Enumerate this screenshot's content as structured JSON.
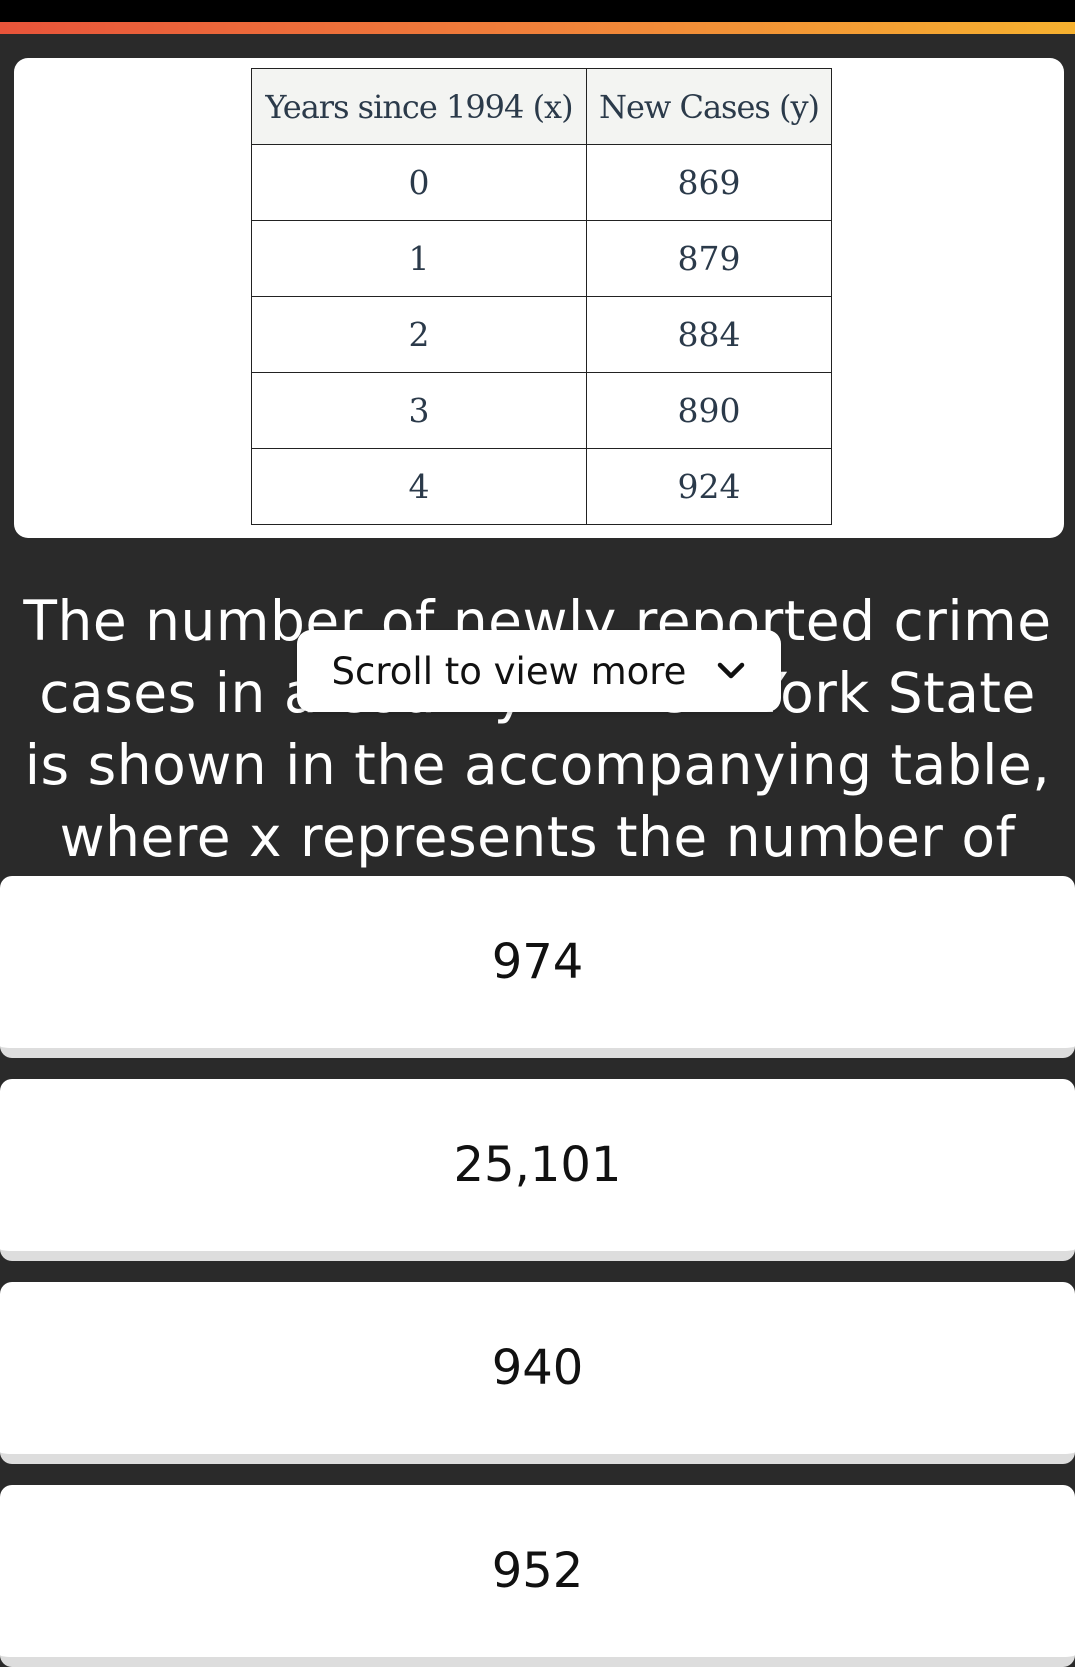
{
  "colors": {
    "background": "#2a2a2a",
    "accent_gradient": [
      "#e8543a",
      "#f6b12f"
    ]
  },
  "table": {
    "headers": [
      "Years since 1994 (x)",
      "New Cases (y)"
    ],
    "rows": [
      [
        "0",
        "869"
      ],
      [
        "1",
        "879"
      ],
      [
        "2",
        "884"
      ],
      [
        "3",
        "890"
      ],
      [
        "4",
        "924"
      ]
    ]
  },
  "question": {
    "text": "The number of newly reported crime cases in a county in New York State is shown in the accompanying table, where x represents the number of"
  },
  "tooltip": {
    "label": "Scroll to view more",
    "icon": "chevron-down-icon"
  },
  "answers": [
    {
      "label": "974"
    },
    {
      "label": "25,101"
    },
    {
      "label": "940"
    },
    {
      "label": "952"
    }
  ]
}
